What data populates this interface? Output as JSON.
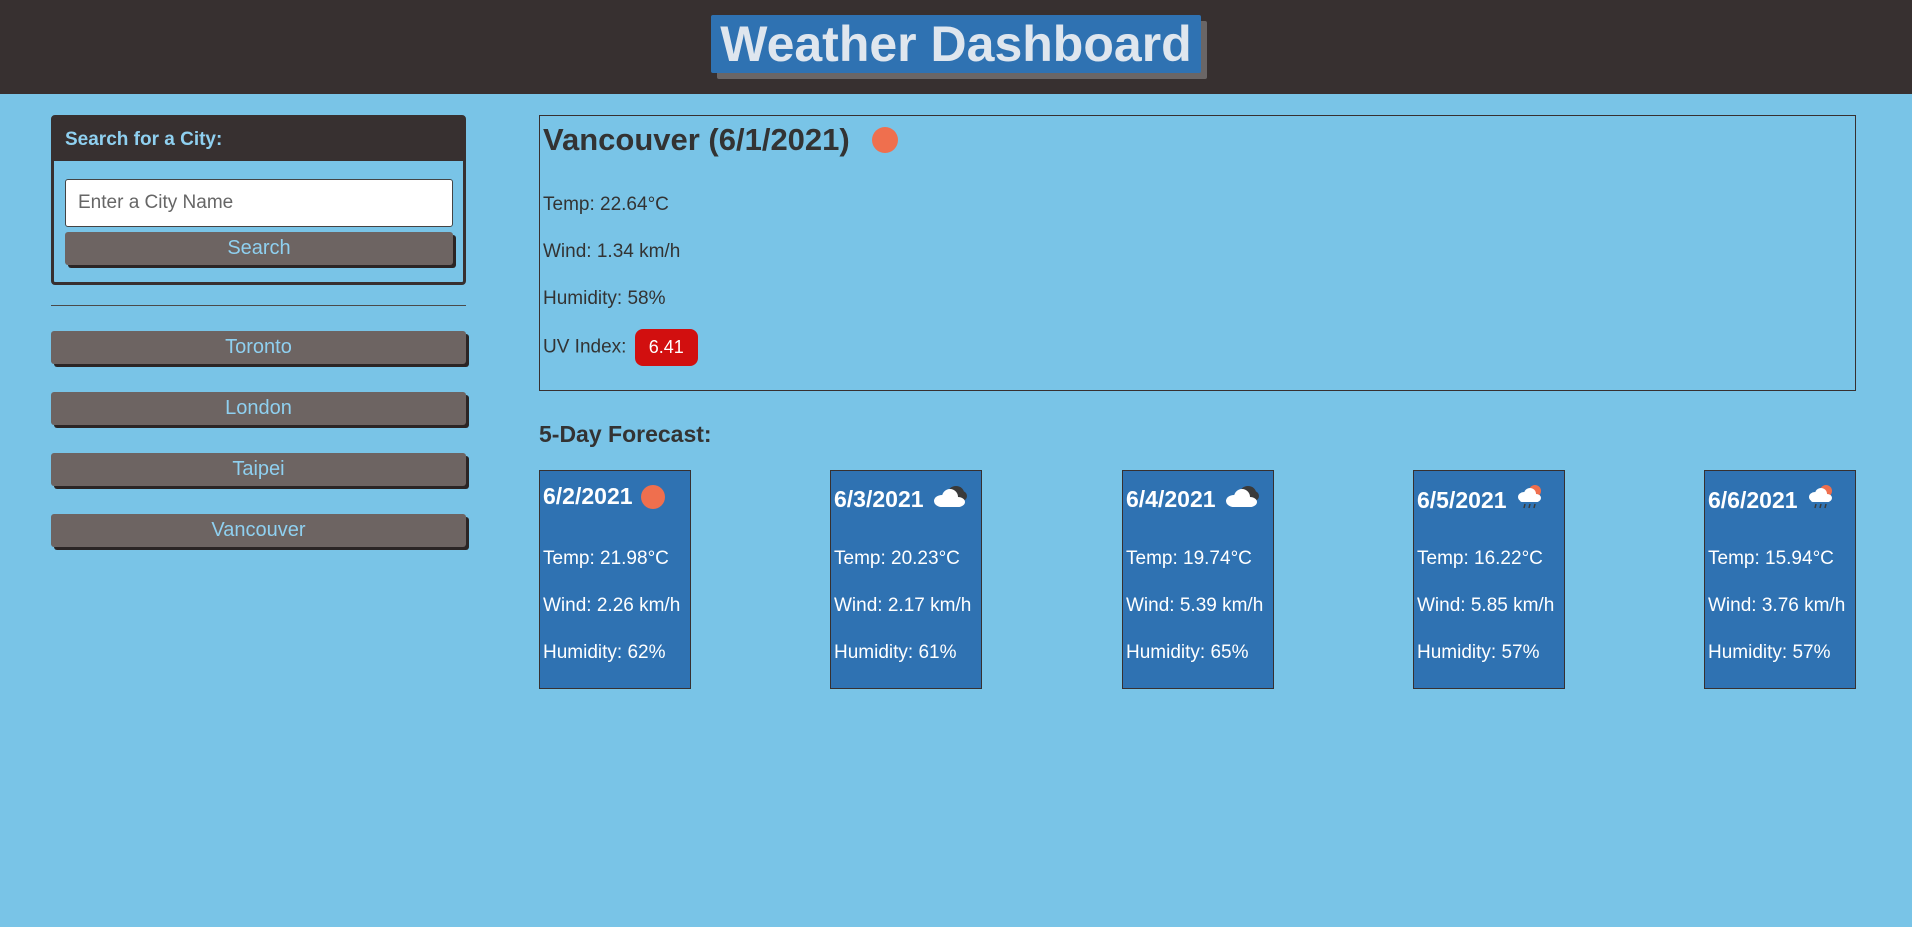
{
  "header": {
    "title": "Weather Dashboard"
  },
  "sidebar": {
    "search_heading": "Search for a City:",
    "search_placeholder": "Enter a City Name",
    "search_button": "Search",
    "history": [
      "Toronto",
      "London",
      "Taipei",
      "Vancouver"
    ]
  },
  "current": {
    "title": "Vancouver (6/1/2021)",
    "icon": "sun-icon",
    "temp": "Temp: 22.64°C",
    "wind": "Wind: 1.34 km/h",
    "humidity": "Humidity: 58%",
    "uv_label": "UV Index:",
    "uv_value": "6.41",
    "uv_color": "#d20f0f"
  },
  "forecast": {
    "heading": "5-Day Forecast:",
    "days": [
      {
        "date": "6/2/2021",
        "icon": "sun-icon",
        "temp": "Temp: 21.98°C",
        "wind": "Wind: 2.26 km/h",
        "humidity": "Humidity: 62%"
      },
      {
        "date": "6/3/2021",
        "icon": "cloudy-icon",
        "temp": "Temp: 20.23°C",
        "wind": "Wind: 2.17 km/h",
        "humidity": "Humidity: 61%"
      },
      {
        "date": "6/4/2021",
        "icon": "cloudy-icon",
        "temp": "Temp: 19.74°C",
        "wind": "Wind: 5.39 km/h",
        "humidity": "Humidity: 65%"
      },
      {
        "date": "6/5/2021",
        "icon": "rain-sun-icon",
        "temp": "Temp: 16.22°C",
        "wind": "Wind: 5.85 km/h",
        "humidity": "Humidity: 57%"
      },
      {
        "date": "6/6/2021",
        "icon": "rain-sun-icon",
        "temp": "Temp: 15.94°C",
        "wind": "Wind: 3.76 km/h",
        "humidity": "Humidity: 57%"
      }
    ]
  },
  "colors": {
    "page_bg": "#79c4e7",
    "header_bg": "#373030",
    "accent_blue": "#2f72b2",
    "button_bg": "#6d6462",
    "sun": "#ef6f4e"
  }
}
